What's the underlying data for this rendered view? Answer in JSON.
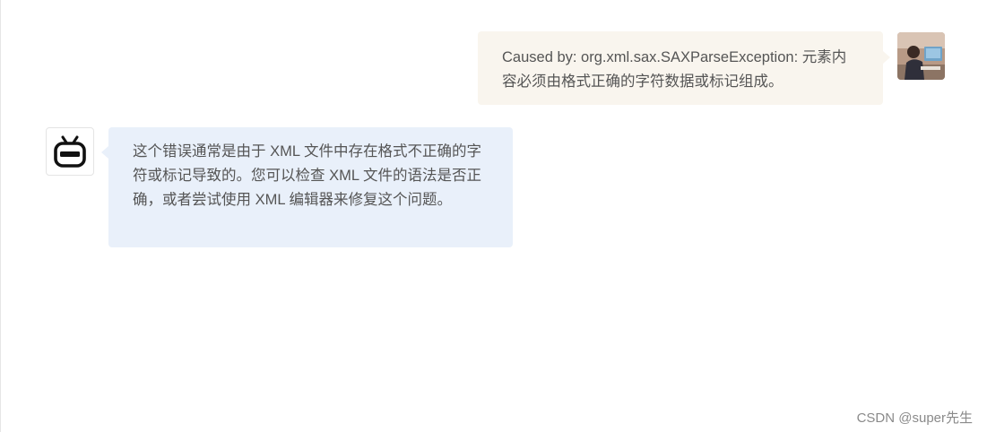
{
  "chat": {
    "user_message": {
      "text": "Caused by: org.xml.sax.SAXParseException: 元素内容必须由格式正确的字符数据或标记组成。",
      "avatar_icon": "user-photo-avatar"
    },
    "bot_message": {
      "text": "这个错误通常是由于 XML 文件中存在格式不正确的字符或标记导致的。您可以检查 XML 文件的语法是否正确，或者尝试使用 XML 编辑器来修复这个问题。",
      "avatar_icon": "robot-icon"
    }
  },
  "watermark": {
    "text": "CSDN @super先生"
  },
  "colors": {
    "user_bubble": "#f9f5ee",
    "bot_bubble": "#e9f0fa",
    "text": "#555555"
  }
}
